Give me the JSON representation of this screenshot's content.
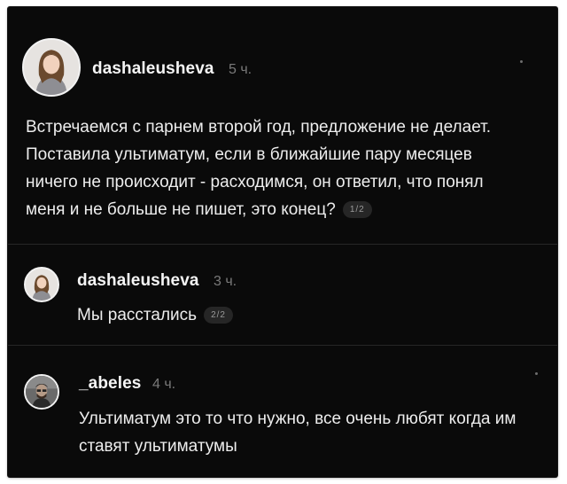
{
  "posts": [
    {
      "username": "dashaleusheva",
      "time": "5 ч.",
      "text": "Встречаемся с парнем второй год, предложение не делает. Поставила ультиматум, если в ближайшие пару месяцев ничего не происходит - расходимся, он ответил, что понял меня и не больше не пишет, это конец?",
      "page": "1/2",
      "avatar_icon": "avatar-woman-photo"
    },
    {
      "username": "dashaleusheva",
      "time": "3 ч.",
      "text": "Мы расстались",
      "page": "2/2",
      "avatar_icon": "avatar-woman-photo"
    },
    {
      "username": "_abeles",
      "time": "4 ч.",
      "text": "Ультиматум это то что нужно, все очень любят когда им ставят ультиматумы",
      "avatar_icon": "avatar-man-photo"
    }
  ],
  "colors": {
    "background": "#0a0a0a",
    "text": "#ededed",
    "muted": "#7a7a7a",
    "divider": "#262626"
  }
}
